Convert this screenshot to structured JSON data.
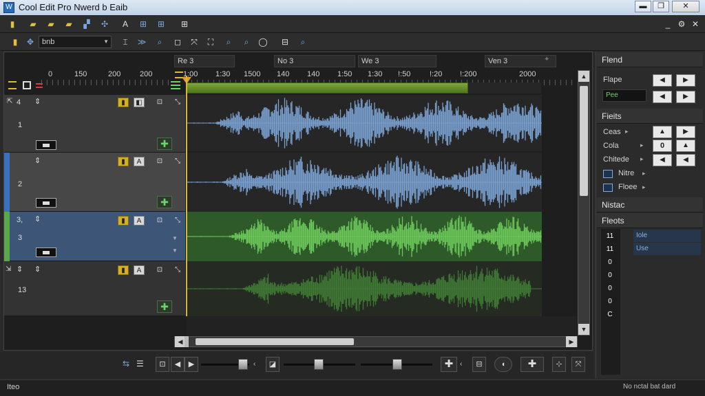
{
  "window": {
    "title": "Cool Edit Pro Nwerd b Eaib",
    "buttons": [
      "▬",
      "❐",
      "✕"
    ]
  },
  "menubar_icons": [
    "📄",
    "📁",
    "📁",
    "📁",
    "▞",
    "✣",
    "A",
    "⊞",
    "⊞",
    "⊞"
  ],
  "window_controls_inner": [
    "_",
    "⚙",
    "✕"
  ],
  "toolbar2": {
    "zoom_value": "bnb"
  },
  "tabs": [
    {
      "label": "Re 3"
    },
    {
      "label": "No 3"
    },
    {
      "label": "We 3"
    },
    {
      "label": "Ven 3"
    }
  ],
  "ruler": {
    "left_ticks": [
      "0",
      "150",
      "200",
      "200"
    ],
    "ticks": [
      "1:00",
      "1:30",
      "1500",
      "140",
      "140",
      "1:50",
      "1:30",
      "!:50",
      "!:20",
      "!:200",
      "2000"
    ]
  },
  "tracks": [
    {
      "id_label": "4",
      "number": "1",
      "color": "#3a3a3a",
      "waveform_color": "#7aa0d0",
      "lane_bg": "#262626"
    },
    {
      "id_label": "",
      "number": "2",
      "color": "#474747",
      "waveform_color": "#7aa0d0",
      "lane_bg": "#262626"
    },
    {
      "id_label": "3,",
      "number": "3",
      "color": "#3d5678",
      "waveform_color": "#5ba84a",
      "lane_bg": "#2e5a2a"
    },
    {
      "id_label": "",
      "number": "13",
      "color": "#333333",
      "waveform_color": "#3f7a34",
      "lane_bg": "#252a22"
    }
  ],
  "right_panel": {
    "section1_title": "Flend",
    "shape_label": "Flape",
    "shape_value": "Pee",
    "section2_title": "Fieits",
    "rows": [
      {
        "label": "Ceas",
        "value": ""
      },
      {
        "label": "Cola",
        "value": "0"
      },
      {
        "label": "Chitede",
        "value": ""
      }
    ],
    "checks": [
      {
        "label": "Nitre"
      },
      {
        "label": "Floee"
      }
    ],
    "section3_title": "Nistac",
    "section4_title": "Fleots",
    "presets_left": [
      "11",
      "11",
      "0",
      "0",
      "0",
      "0",
      "C"
    ],
    "presets_right": [
      "Iole",
      "Use"
    ]
  },
  "status": {
    "left": "Iteo",
    "right": "No nctal bat dard"
  },
  "colors": {
    "accent_blue": "#3b6fbf",
    "accent_green": "#5aa84a",
    "playhead": "#d8b73a"
  }
}
